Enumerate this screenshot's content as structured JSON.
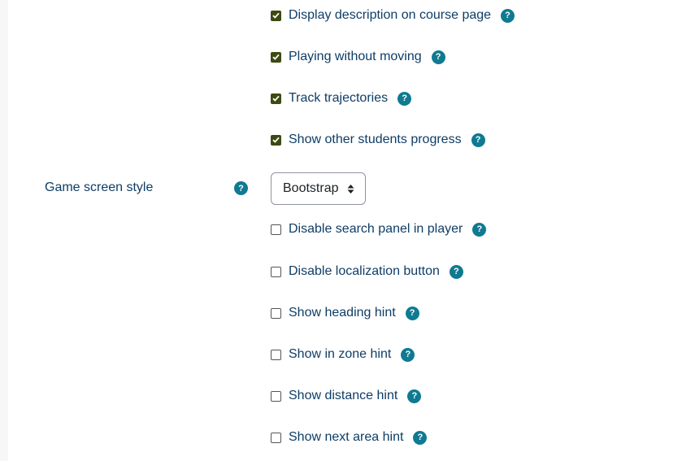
{
  "checkboxes_top": [
    {
      "label": "Display description on course page",
      "checked": true
    },
    {
      "label": "Playing without moving",
      "checked": true
    },
    {
      "label": "Track trajectories",
      "checked": true
    },
    {
      "label": "Show other students progress",
      "checked": true
    }
  ],
  "game_screen_style": {
    "label": "Game screen style",
    "value": "Bootstrap"
  },
  "checkboxes_bottom": [
    {
      "label": "Disable search panel in player",
      "checked": false
    },
    {
      "label": "Disable localization button",
      "checked": false
    },
    {
      "label": "Show heading hint",
      "checked": false
    },
    {
      "label": "Show in zone hint",
      "checked": false
    },
    {
      "label": "Show distance hint",
      "checked": false
    },
    {
      "label": "Show next area hint",
      "checked": false
    }
  ],
  "help_glyph": "?",
  "colors": {
    "label": "#0f3d66",
    "help_badge": "#0f7a91",
    "checkbox_checked": "#3d4a13"
  },
  "icons": {
    "help": "question-circle-icon",
    "check": "checkmark-icon",
    "select": "sort-arrows-icon"
  }
}
